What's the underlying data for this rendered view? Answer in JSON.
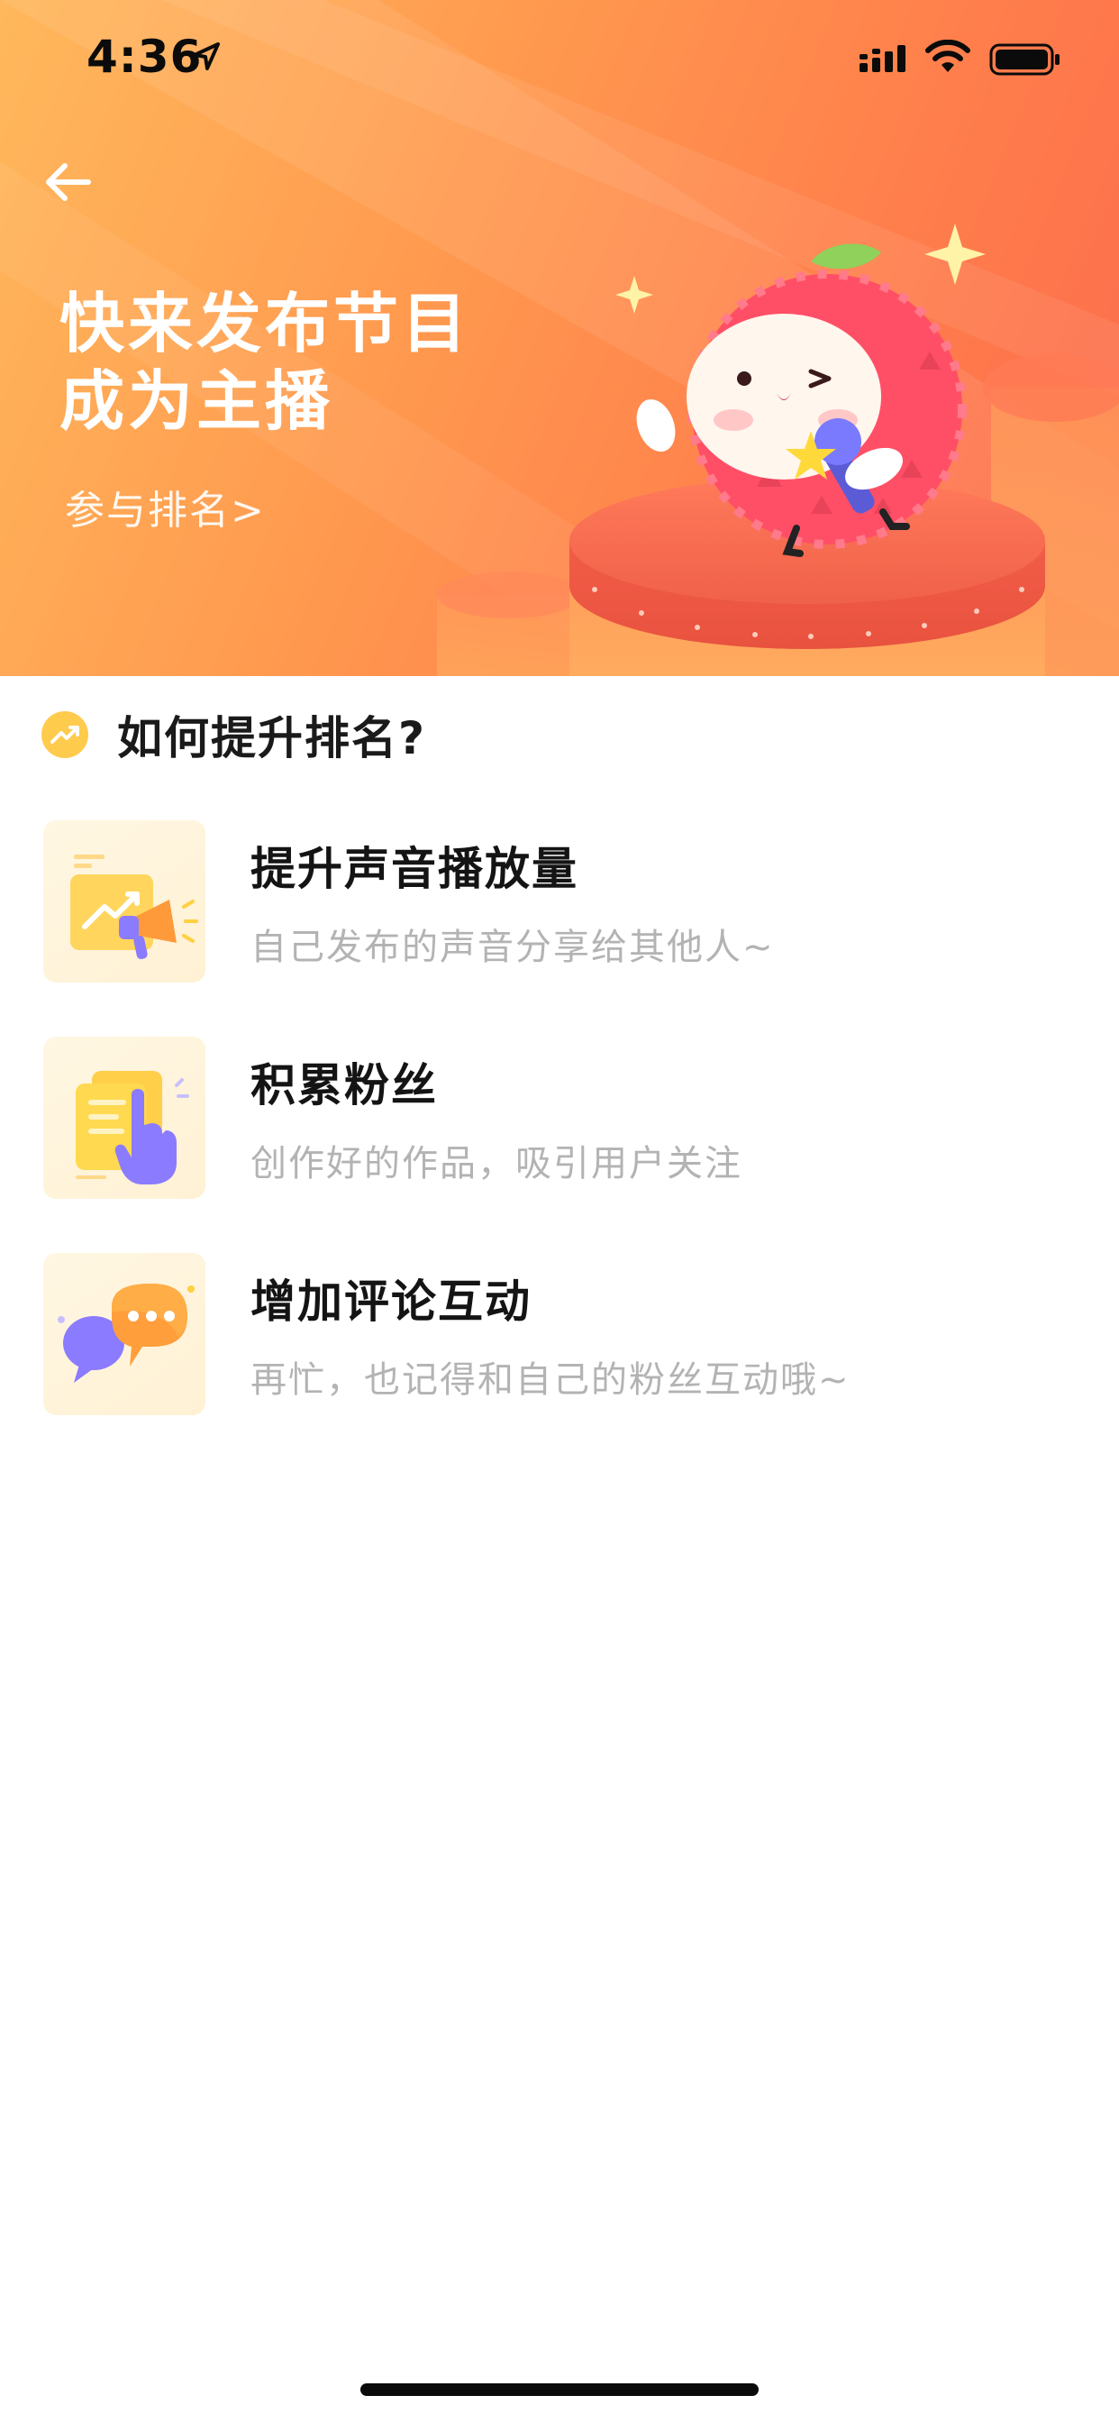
{
  "status_bar": {
    "time": "4:36"
  },
  "hero": {
    "title_line1": "快来发布节目",
    "title_line2": "成为主播",
    "rank_link": "参与排名>"
  },
  "section": {
    "title": "如何提升排名?"
  },
  "tips": [
    {
      "title": "提升声音播放量",
      "desc": "自己发布的声音分享给其他人~",
      "icon": "megaphone-chart-icon"
    },
    {
      "title": "积累粉丝",
      "desc": "创作好的作品，吸引用户关注",
      "icon": "document-hand-icon"
    },
    {
      "title": "增加评论互动",
      "desc": "再忙，也记得和自己的粉丝互动哦~",
      "icon": "chat-bubbles-icon"
    }
  ],
  "colors": {
    "hero_gradient_start": "#ffb85c",
    "hero_gradient_end": "#fb6b4d",
    "title_text": "#141414",
    "desc_text": "#b3b3b3",
    "accent_yellow": "#ffc94a",
    "accent_purple": "#8b7bff"
  }
}
